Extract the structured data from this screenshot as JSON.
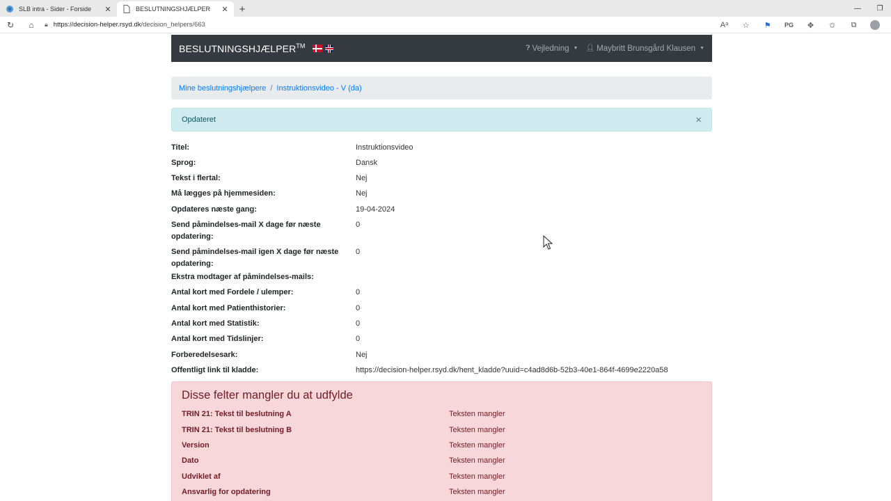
{
  "browser": {
    "tabs": [
      {
        "title": "SLB intra - Sider - Forside",
        "active": false
      },
      {
        "title": "BESLUTNINGSHJÆLPER",
        "active": true
      }
    ],
    "url_host": "https://decision-helper.rsyd.dk",
    "url_path": "/decision_helpers/663"
  },
  "navbar": {
    "brand": "BESLUTNINGSHJÆLPER",
    "brand_sup": "TM",
    "guide_label": "Vejledning",
    "user_label": "Maybritt Brunsgård Klausen"
  },
  "breadcrumb": {
    "items": [
      "Mine beslutningshjælpere",
      "Instruktionsvideo - V (da)"
    ],
    "separator": "/"
  },
  "alert": {
    "message": "Opdateret",
    "close": "×"
  },
  "details": [
    {
      "label": "Titel:",
      "value": "Instruktionsvideo"
    },
    {
      "label": "Sprog:",
      "value": "Dansk"
    },
    {
      "label": "Tekst i flertal:",
      "value": "Nej"
    },
    {
      "label": "Må lægges på hjemmesiden:",
      "value": "Nej"
    },
    {
      "label": "Opdateres næste gang:",
      "value": "19-04-2024"
    },
    {
      "label": "Send påmindelses-mail X dage før næste opdatering:",
      "value": "0"
    },
    {
      "label": "Send påmindelses-mail igen X dage før næste opdatering:",
      "value": "0"
    },
    {
      "label": "Ekstra modtager af påmindelses-mails:",
      "value": ""
    },
    {
      "label": "Antal kort med Fordele / ulemper:",
      "value": "0"
    },
    {
      "label": "Antal kort med Patienthistorier:",
      "value": "0"
    },
    {
      "label": "Antal kort med Statistik:",
      "value": "0"
    },
    {
      "label": "Antal kort med Tidslinjer:",
      "value": "0"
    },
    {
      "label": "Forberedelsesark:",
      "value": "Nej"
    },
    {
      "label": "Offentligt link til kladde:",
      "value": "https://decision-helper.rsyd.dk/hent_kladde?uuid=c4ad8d6b-52b3-40e1-864f-4699e2220a58"
    }
  ],
  "missing": {
    "heading": "Disse felter mangler du at udfylde",
    "items": [
      {
        "field": "TRIN 21: Tekst til beslutning A",
        "status": "Teksten mangler"
      },
      {
        "field": "TRIN 21: Tekst til beslutning B",
        "status": "Teksten mangler"
      },
      {
        "field": "Version",
        "status": "Teksten mangler"
      },
      {
        "field": "Dato",
        "status": "Teksten mangler"
      },
      {
        "field": "Udviklet af",
        "status": "Teksten mangler"
      },
      {
        "field": "Ansvarlig for opdatering",
        "status": "Teksten mangler"
      }
    ]
  },
  "colors": {
    "navbar_bg": "#343a40",
    "link": "#007bff",
    "info_bg": "#d1ecf1",
    "danger_bg": "#f8d7da",
    "danger_text": "#721c24"
  }
}
